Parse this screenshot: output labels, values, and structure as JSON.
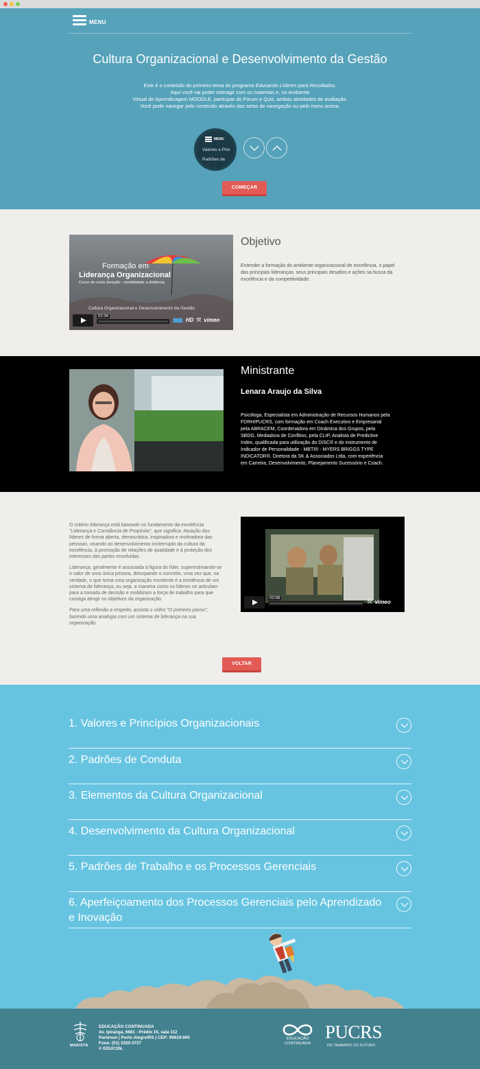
{
  "header": {
    "menu_label": "MENU",
    "title": "Cultura Organizacional e Desenvolvimento da Gestão",
    "intro": {
      "l1_before": "Este é o conteúdo do primeiro tema do programa ",
      "l1_emph": "Educando Líderes para Resultados.",
      "l2": "Aqui você vai poder interagir com os materiais e, no Ambiente",
      "l3": "Virtual de Aprendizagem MOODLE, participar do Fórum e Quiz, ambas atividades de avaliação.",
      "l4": "Você pode navegar pelo conteúdo através das setas de navegação ou pelo menu acima."
    },
    "preview": {
      "menu": "MENU",
      "line1": "Valores e Prin",
      "line2": "Padrões de"
    },
    "start_button": "COMEÇAR"
  },
  "objetivo": {
    "title": "Objetivo",
    "text": "Entender a formação do ambiente organizacional de excelência, o papel das principais lideranças, seus principais desafios e ações na busca da excelência e da competitividade.",
    "video": {
      "headline1": "Formação em",
      "headline2": "Liderança Organizacional",
      "subline": "Curso de curta duração - modalidade a distância",
      "caption": "Cultura Organizacional e Desenvolvimento da Gestão",
      "time": "02:34",
      "hd": "HD",
      "brand": "vimeo"
    }
  },
  "ministrante": {
    "title": "Ministrante",
    "name": "Lenara Araujo da Silva",
    "bio": "Psicóloga, Especialista em Administração de Recursos Humanos pela FDRH/PUCRS, com formação em Coach Executivo e Empresarial pela ABRACEM, Coordenadora em Dinâmica dos Grupos, pela SBDG, Mediadora de Conflitos, pela CLIP, Analista de Predictive Index, qualificada para utilização do DISC® e do instrumento de Indicador de Personalidade - MBTI® - MYERS BRIGGS TYPE INDICATOR®. Diretora da SK & Associados Ltda, com experiência em Carreira, Desenvolvimento, Planejamento Sucessório e Coach."
  },
  "criterio": {
    "p1": "O critério liderança está baseado no fundamento da excelência \"Liderança e Constância de Propósito\", que significa: Atuação dos líderes de forma aberta, democrática, inspiradora e motivadora das pessoas, visando ao desenvolvimento ininterrupto da cultura da excelência, à promoção de relações de qualidade e à proteção dos interesses das partes envolvidas.",
    "p2": "Liderança, geralmente é associada à figura do líder, superestimando-se o valor de uma única pessoa, deturpando o conceito, uma vez que, na verdade, o que torna uma organização excelente é a existência de um sistema de liderança, ou seja, a maneira como os líderes se articulam para a tomada de decisão e mobilizam a força de trabalho para que consiga atingir os objetivos da organização.",
    "p3": "Para uma reflexão a respeito, assista o vídeo \"O primeiro passo\", fazendo uma analogia com um sistema de liderança na sua organização.",
    "video_time": "02:08",
    "video_brand": "vimeo",
    "back_button": "VOLTAR"
  },
  "topics": [
    {
      "label": "1. Valores e Princípios Organizacionais"
    },
    {
      "label": "2. Padrões de Conduta"
    },
    {
      "label": "3. Elementos da Cultura Organizacional"
    },
    {
      "label": "4. Desenvolvimento da Cultura Organizacional"
    },
    {
      "label": "5. Padrões de Trabalho e os Processos Gerenciais"
    },
    {
      "label": "6. Aperfeiçoamento dos Processos Gerenciais pelo Aprendizado e Inovação"
    }
  ],
  "footer": {
    "address": {
      "l1": "EDUCAÇÃO CONTINUADA",
      "l2": "Av. Ipiranga, 6681 - Prédio 15, sala 112",
      "l3": "Partenon | Porto Alegre/RS | CEP: 90619-900",
      "l4": "Fone: (51) 3320-3727",
      "l5": "© EDUCON."
    },
    "marista": "MARISTA",
    "edu_label1": "EDUCAÇÃO",
    "edu_label2": "CONTINUADA",
    "pucrs": "PUCRS",
    "pucrs_tag": "DO TAMANHO DO FUTURO"
  },
  "colors": {
    "hero_bg": "#55a2ba",
    "topics_bg": "#66c4e1",
    "footer_bg": "#43818f",
    "accent_button": "#e25b55",
    "content_bg": "#efeeea"
  },
  "icons": [
    "menu-icon",
    "chevron-down-icon",
    "chevron-up-icon",
    "play-icon",
    "fullscreen-icon",
    "volume-icon",
    "infinity-logo-icon",
    "marista-logo-icon"
  ]
}
